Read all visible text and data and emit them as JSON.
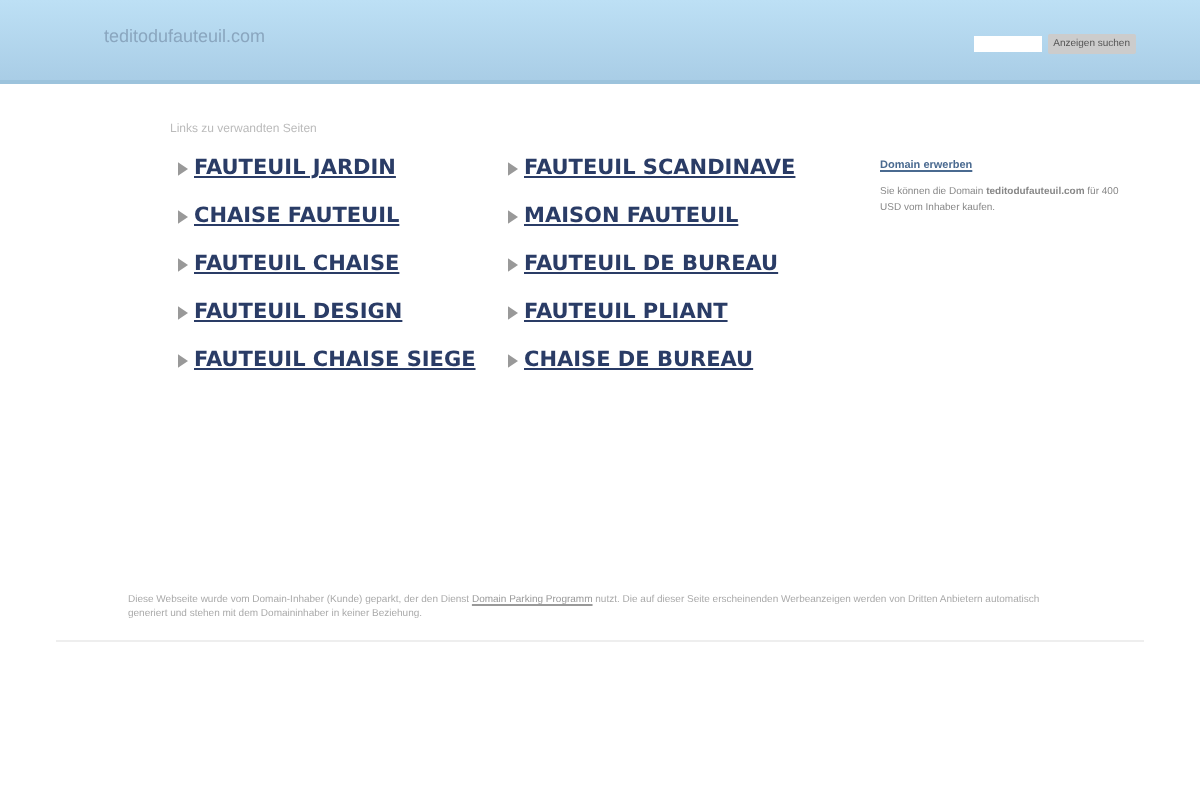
{
  "header": {
    "site_title": "teditodufauteuil.com",
    "search_button": "Anzeigen suchen"
  },
  "links_heading": "Links zu verwandten Seiten",
  "links": [
    {
      "label": "FAUTEUIL JARDIN"
    },
    {
      "label": "FAUTEUIL SCANDINAVE"
    },
    {
      "label": "CHAISE FAUTEUIL"
    },
    {
      "label": "MAISON FAUTEUIL"
    },
    {
      "label": "FAUTEUIL CHAISE"
    },
    {
      "label": "FAUTEUIL DE BUREAU"
    },
    {
      "label": "FAUTEUIL DESIGN"
    },
    {
      "label": "FAUTEUIL PLIANT"
    },
    {
      "label": "FAUTEUIL CHAISE SIEGE"
    },
    {
      "label": "CHAISE DE BUREAU"
    }
  ],
  "sidebar": {
    "title": "Domain erwerben",
    "text": "Sie können die Domain **teditodufauteuil.com** für 400 USD vom Inhaber kaufen."
  },
  "footer": {
    "before": "Diese Webseite wurde vom Domain-Inhaber (Kunde) geparkt, der den Dienst",
    "link": "Domain Parking Programm",
    "after": "nutzt. Die auf dieser Seite erscheinenden Werbeanzeigen werden von Dritten Anbietern automatisch generiert und stehen mit dem Domaininhaber in keiner Beziehung."
  }
}
